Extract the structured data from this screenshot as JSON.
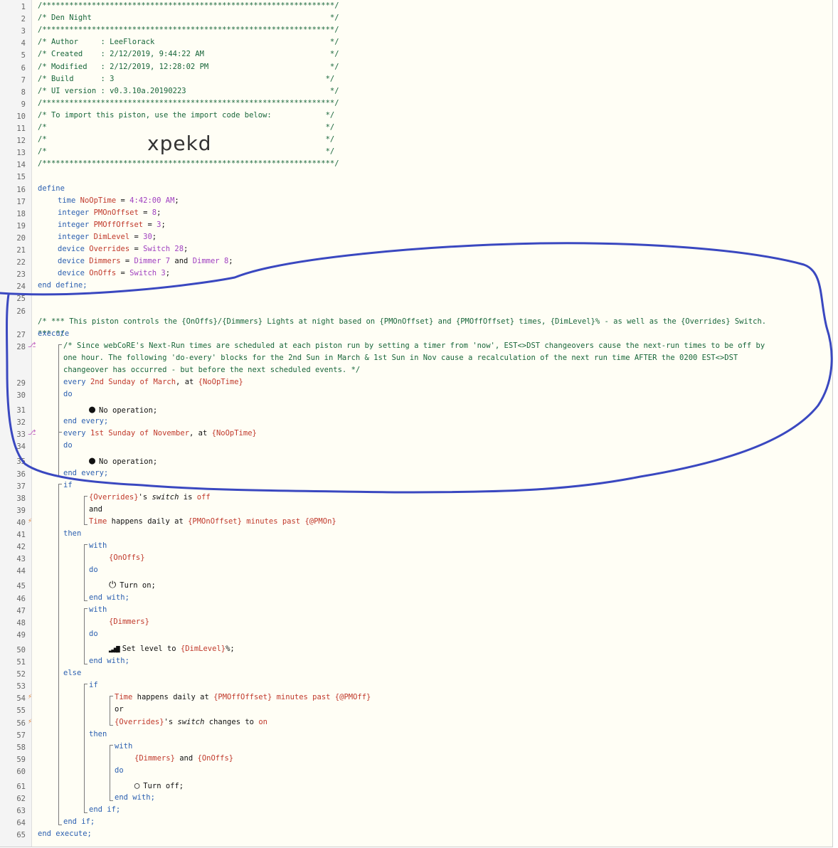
{
  "line_numbers": [
    "1",
    "2",
    "3",
    "4",
    "5",
    "6",
    "7",
    "8",
    "9",
    "10",
    "11",
    "12",
    "13",
    "14",
    "15",
    "16",
    "17",
    "18",
    "19",
    "20",
    "21",
    "22",
    "23",
    "24",
    "25",
    "26",
    "27",
    "28",
    "29",
    "30",
    "31",
    "32",
    "33",
    "34",
    "35",
    "36",
    "37",
    "38",
    "39",
    "40",
    "41",
    "42",
    "43",
    "44",
    "45",
    "46",
    "47",
    "48",
    "49",
    "50",
    "51",
    "52",
    "53",
    "54",
    "55",
    "56",
    "57",
    "58",
    "59",
    "60",
    "61",
    "62",
    "63",
    "64",
    "65"
  ],
  "header": {
    "stars": "/*****************************************************************/",
    "title_line": "/* Den Night                                                     */",
    "author_line": "/* Author     : LeeFlorack                                       */",
    "created_line": "/* Created    : 2/12/2019, 9:44:22 AM                            */",
    "modified_line": "/* Modified   : 2/12/2019, 12:28:02 PM                           */",
    "build_line": "/* Build      : 3                                               */",
    "ui_line": "/* UI version : v0.3.10a.20190223                                */",
    "import_line": "/* To import this piston, use the import code below:            */",
    "empty_line": "/*                                                              */",
    "import_code": "xpekd"
  },
  "define": {
    "kw_define": "define",
    "kw_end": "end define;",
    "vars": [
      {
        "type": "time",
        "name": "NoOpTime",
        "eq": " = ",
        "value": "4:42:00 AM",
        "end": ";"
      },
      {
        "type": "integer",
        "name": "PMOnOffset",
        "eq": " = ",
        "value": "8",
        "end": ";"
      },
      {
        "type": "integer",
        "name": "PMOffOffset",
        "eq": " = ",
        "value": "3",
        "end": ";"
      },
      {
        "type": "integer",
        "name": "DimLevel",
        "eq": " = ",
        "value": "30",
        "end": ";"
      }
    ],
    "devices": [
      {
        "type": "device",
        "name": "Overrides",
        "eq": " = ",
        "value": "Switch 28",
        "end": ";"
      },
      {
        "type": "device",
        "name": "Dimmers",
        "eq": " = ",
        "value": "Dimmer 7",
        "and": " and ",
        "value2": "Dimmer 8",
        "end": ";"
      },
      {
        "type": "device",
        "name": "OnOffs",
        "eq": " = ",
        "value": "Switch 3",
        "end": ";"
      }
    ]
  },
  "comment26": "/* *** This piston controls the {OnOffs}/{Dimmers} Lights at night based on {PMOnOffset} and {PMOffOffset} times, {DimLevel}% - as well as the {Overrides} Switch.",
  "comment26b": "*** */",
  "execute": "execute",
  "end_execute": "end execute;",
  "comment28a": "/* Since webCoRE's Next-Run times are scheduled at each piston run by setting a timer from 'now', EST<>DST changeovers cause the next-run times to be off by",
  "comment28b": "one hour. The following 'do-every' blocks for the 2nd Sun in March & 1st Sun in Nov cause a recalculation of the next run time AFTER the 0200 EST<>DST",
  "comment28c": "changeover has occurred - but before the next scheduled events. */",
  "every1": {
    "kw": "every ",
    "text": "2nd Sunday of March",
    "sep": ", at ",
    "var": "{NoOpTime}"
  },
  "every2": {
    "kw": "every ",
    "text": "1st Sunday of November",
    "sep": ", at ",
    "var": "{NoOpTime}"
  },
  "do": "do",
  "nop": "No operation;",
  "end_every": "end every;",
  "if": "if",
  "and": "and",
  "or": "or",
  "then": "then",
  "else": "else",
  "with": "with",
  "end_with": "end with;",
  "end_if": "end if;",
  "cond1": {
    "dev": "{Overrides}",
    "mid": "'s ",
    "attr": "switch",
    "is": " is ",
    "val": "off"
  },
  "cond2": {
    "t": "Time",
    "mid": " happens daily at ",
    "var": "{PMOnOffset}",
    "mins": " minutes past ",
    "var2": "{@PMOn}"
  },
  "cond3": {
    "t": "Time",
    "mid": " happens daily at ",
    "var": "{PMOffOffset}",
    "mins": " minutes past ",
    "var2": "{@PMOff}"
  },
  "cond4": {
    "dev": "{Overrides}",
    "mid": "'s ",
    "attr": "switch",
    "is": " changes to ",
    "val": "on"
  },
  "with1_dev": "{OnOffs}",
  "with2_dev": "{Dimmers}",
  "with3_dev1": "{Dimmers}",
  "with3_and": " and ",
  "with3_dev2": "{OnOffs}",
  "turn_on": "Turn on;",
  "set_level": "Set level to ",
  "set_level_var": "{DimLevel}",
  "set_level_end": "%;",
  "turn_off": "Turn off;",
  "colors": {
    "annotation": "#3a48c0",
    "comment": "#18663a",
    "keyword": "#2b5fb0",
    "value": "#c0392b",
    "purple": "#a040c0"
  }
}
